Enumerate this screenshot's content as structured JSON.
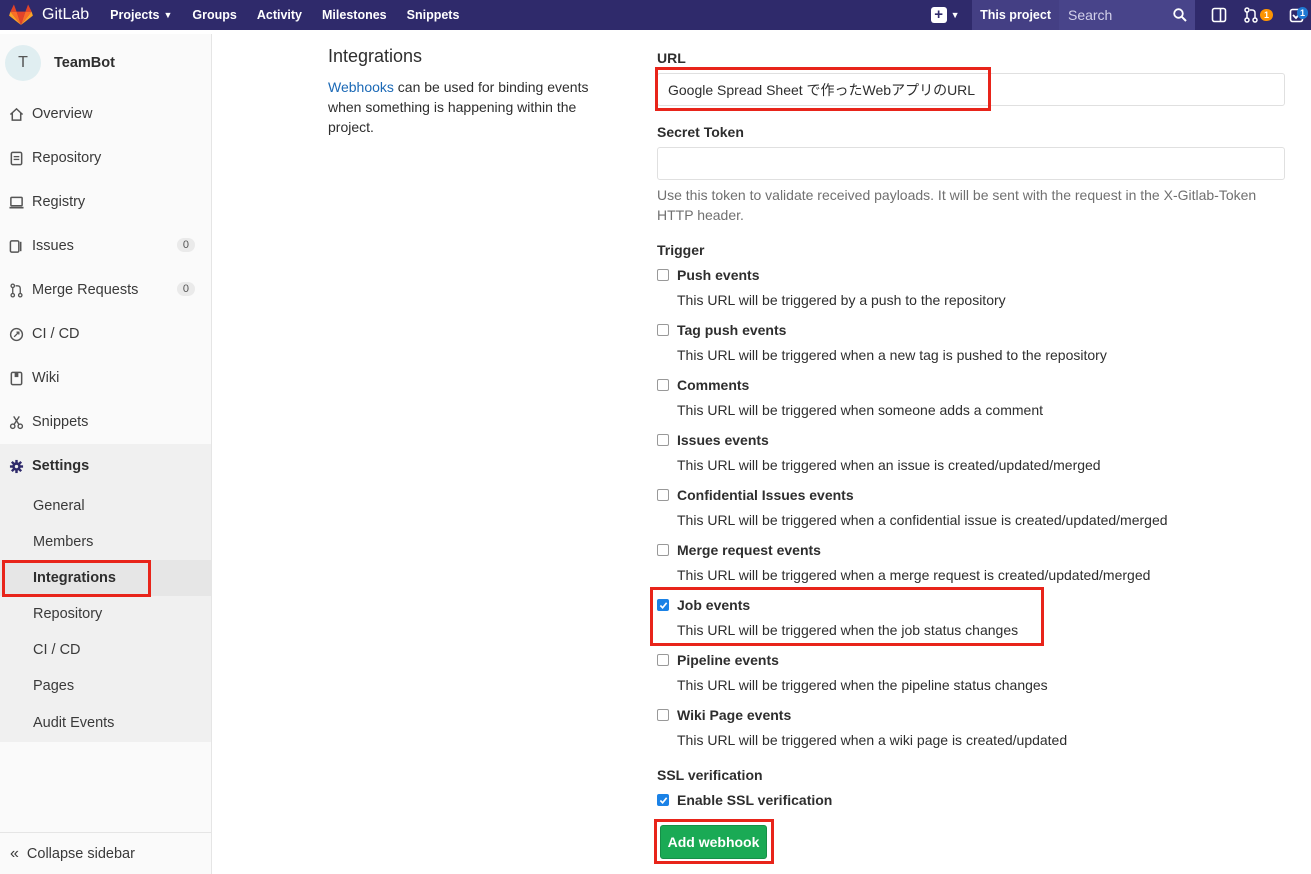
{
  "topnav": {
    "brand": "GitLab",
    "links": [
      {
        "label": "Projects",
        "dropdown": true
      },
      {
        "label": "Groups",
        "dropdown": false
      },
      {
        "label": "Activity",
        "dropdown": false
      },
      {
        "label": "Milestones",
        "dropdown": false
      },
      {
        "label": "Snippets",
        "dropdown": false
      }
    ],
    "this_project": "This project",
    "search_placeholder": "Search",
    "merge_requests_count": "1",
    "todos_count": "1"
  },
  "sidebar": {
    "avatar_letter": "T",
    "project_name": "TeamBot",
    "items": [
      {
        "label": "Overview",
        "icon": "home-icon"
      },
      {
        "label": "Repository",
        "icon": "doc-icon"
      },
      {
        "label": "Registry",
        "icon": "laptop-icon"
      },
      {
        "label": "Issues",
        "icon": "issues-icon",
        "count": "0"
      },
      {
        "label": "Merge Requests",
        "icon": "merge-icon",
        "count": "0"
      },
      {
        "label": "CI / CD",
        "icon": "rocket-icon"
      },
      {
        "label": "Wiki",
        "icon": "book-icon"
      },
      {
        "label": "Snippets",
        "icon": "scissors-icon"
      }
    ],
    "settings": {
      "label": "Settings",
      "sub_items": [
        "General",
        "Members",
        "Integrations",
        "Repository",
        "CI / CD",
        "Pages",
        "Audit Events"
      ],
      "active": "Integrations"
    },
    "collapse_label": "Collapse sidebar"
  },
  "intro": {
    "title": "Integrations",
    "link_text": "Webhooks",
    "text": " can be used for binding events when something is happening within the project."
  },
  "form": {
    "url_label": "URL",
    "url_value": "Google Spread Sheet で作ったWebアプリのURL",
    "secret_label": "Secret Token",
    "secret_value": "",
    "secret_help": "Use this token to validate received payloads. It will be sent with the request in the X-Gitlab-Token HTTP header.",
    "trigger_label": "Trigger",
    "triggers": [
      {
        "name": "Push events",
        "desc": "This URL will be triggered by a push to the repository",
        "checked": false
      },
      {
        "name": "Tag push events",
        "desc": "This URL will be triggered when a new tag is pushed to the repository",
        "checked": false
      },
      {
        "name": "Comments",
        "desc": "This URL will be triggered when someone adds a comment",
        "checked": false
      },
      {
        "name": "Issues events",
        "desc": "This URL will be triggered when an issue is created/updated/merged",
        "checked": false
      },
      {
        "name": "Confidential Issues events",
        "desc": "This URL will be triggered when a confidential issue is created/updated/merged",
        "checked": false
      },
      {
        "name": "Merge request events",
        "desc": "This URL will be triggered when a merge request is created/updated/merged",
        "checked": false
      },
      {
        "name": "Job events",
        "desc": "This URL will be triggered when the job status changes",
        "checked": true
      },
      {
        "name": "Pipeline events",
        "desc": "This URL will be triggered when the pipeline status changes",
        "checked": false
      },
      {
        "name": "Wiki Page events",
        "desc": "This URL will be triggered when a wiki page is created/updated",
        "checked": false
      }
    ],
    "ssl_label": "SSL verification",
    "ssl_option": "Enable SSL verification",
    "ssl_checked": true,
    "submit_label": "Add webhook"
  },
  "colors": {
    "nav_bg": "#2f2a6b",
    "highlight_red": "#e8241a",
    "button_green": "#1aaa55",
    "checkbox_blue": "#1b82e6",
    "link_blue": "#1b69b6"
  }
}
